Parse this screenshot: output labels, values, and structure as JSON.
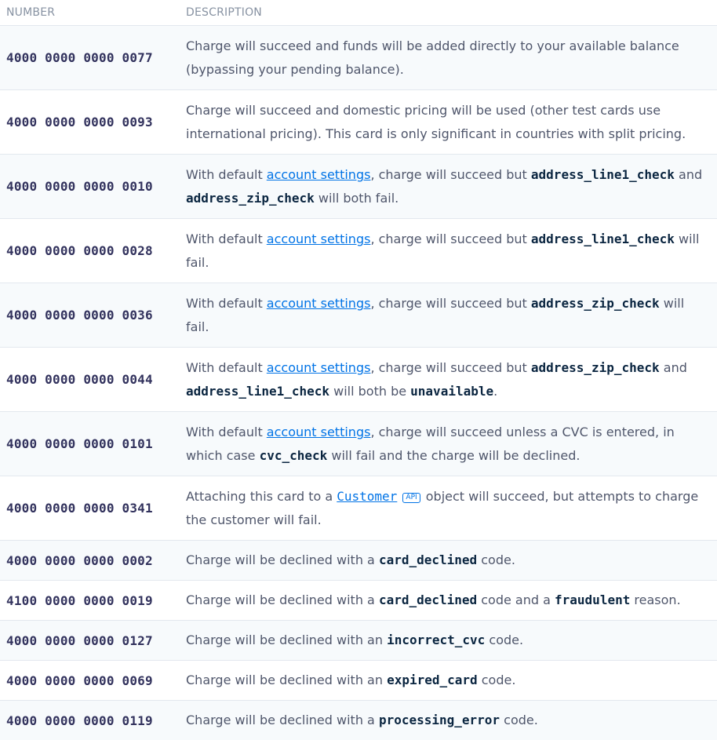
{
  "headers": {
    "number": "NUMBER",
    "description": "DESCRIPTION"
  },
  "rows": [
    {
      "number": "4000 0000 0000 0077",
      "text": "Charge will succeed and funds will be added directly to your available balance (bypassing your pending balance)."
    },
    {
      "number": "4000 0000 0000 0093",
      "text": "Charge will succeed and domestic pricing will be used (other test cards use international pricing). This card is only significant in countries with split pricing."
    },
    {
      "number": "4000 0000 0000 0010",
      "pre": "With default ",
      "link": "account settings",
      "mid": ", charge will succeed but ",
      "code1": "address_line1_check",
      "mid2": " and ",
      "code2": "address_zip_check",
      "post": " will both fail."
    },
    {
      "number": "4000 0000 0000 0028",
      "pre": "With default ",
      "link": "account settings",
      "mid": ", charge will succeed but ",
      "code1": "address_line1_check",
      "post": " will fail."
    },
    {
      "number": "4000 0000 0000 0036",
      "pre": "With default ",
      "link": "account settings",
      "mid": ", charge will succeed but ",
      "code1": "address_zip_check",
      "post": " will fail."
    },
    {
      "number": "4000 0000 0000 0044",
      "pre": "With default ",
      "link": "account settings",
      "mid": ", charge will succeed but ",
      "code1": "address_zip_check",
      "mid2": " and ",
      "code2": "address_line1_check",
      "mid3": " will both be ",
      "code3": "unavailable",
      "post": "."
    },
    {
      "number": "4000 0000 0000 0101",
      "pre": "With default ",
      "link": "account settings",
      "mid": ", charge will succeed unless a CVC is entered, in which case ",
      "code1": "cvc_check",
      "post": " will fail and the charge will be declined."
    },
    {
      "number": "4000 0000 0000 0341",
      "pre": "Attaching this card to a ",
      "code_link": "Customer",
      "badge": "API",
      "post": " object will succeed, but attempts to charge the customer will fail."
    },
    {
      "number": "4000 0000 0000 0002",
      "pre": "Charge will be declined with a ",
      "code1": "card_declined",
      "post": " code."
    },
    {
      "number": "4100 0000 0000 0019",
      "pre": "Charge will be declined with a ",
      "code1": "card_declined",
      "mid2": " code and a ",
      "code2": "fraudulent",
      "post": " reason."
    },
    {
      "number": "4000 0000 0000 0127",
      "pre": "Charge will be declined with an ",
      "code1": "incorrect_cvc",
      "post": " code."
    },
    {
      "number": "4000 0000 0000 0069",
      "pre": "Charge will be declined with an ",
      "code1": "expired_card",
      "post": " code."
    },
    {
      "number": "4000 0000 0000 0119",
      "pre": "Charge will be declined with a ",
      "code1": "processing_error",
      "post": " code."
    }
  ]
}
